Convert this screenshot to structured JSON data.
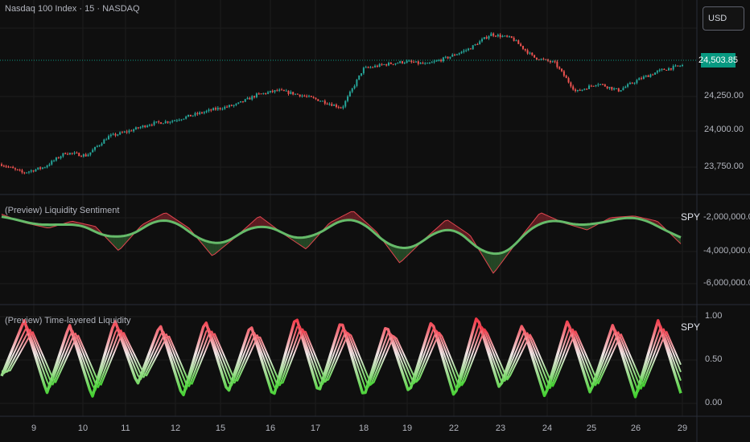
{
  "header": {
    "symbol_title": "Nasdaq 100 Index · 15 · NASDAQ",
    "currency_button": "USD",
    "last_price": "24,503.85"
  },
  "price_axis": [
    "24,250.00",
    "24,000.00",
    "23,750.00"
  ],
  "panes": {
    "liquidity_sentiment": {
      "title": "(Preview) Liquidity Sentiment",
      "badge": "SPY",
      "axis": [
        "-2,000,000.00",
        "-4,000,000.00",
        "-6,000,000.00"
      ]
    },
    "time_layered_liquidity": {
      "title": "(Preview) Time-layered Liquidity",
      "badge": "SPY",
      "axis": [
        "1.00",
        "0.50",
        "0.00"
      ]
    }
  },
  "time_axis": [
    "9",
    "10",
    "11",
    "12",
    "15",
    "16",
    "17",
    "18",
    "19",
    "22",
    "23",
    "24",
    "25",
    "26",
    "29"
  ],
  "colors": {
    "up_candle": "#26a69a",
    "down_candle": "#ef5350",
    "bear_line": "#f23645",
    "bull_fill": "#4caf50",
    "last_price_badge": "#089981"
  },
  "chart_data": [
    {
      "type": "candlestick",
      "title": "Nasdaq 100 Index · 15 · NASDAQ",
      "x": [
        "9",
        "10",
        "11",
        "12",
        "15",
        "16",
        "17",
        "18",
        "19",
        "22",
        "23",
        "24",
        "25",
        "26"
      ],
      "close_path": [
        23820,
        23760,
        23800,
        23900,
        23880,
        24010,
        24050,
        24100,
        24120,
        24160,
        24200,
        24230,
        24300,
        24330,
        24300,
        24260,
        24210,
        24480,
        24510,
        24530,
        24510,
        24560,
        24620,
        24720,
        24690,
        24560,
        24520,
        24320,
        24380,
        24330,
        24410,
        24470,
        24503.85
      ],
      "last": 24503.85,
      "ylim": [
        23650,
        24900
      ]
    },
    {
      "type": "area",
      "title": "(Preview) Liquidity Sentiment",
      "series": [
        {
          "name": "SPY",
          "values": [
            -1800000,
            -2300000,
            -2600000,
            -2200000,
            -2500000,
            -3900000,
            -2400000,
            -1700000,
            -2600000,
            -4200000,
            -3100000,
            -1900000,
            -2900000,
            -3800000,
            -2300000,
            -1600000,
            -2800000,
            -4600000,
            -3300000,
            -2100000,
            -3000000,
            -5200000,
            -3400000,
            -1700000,
            -2300000,
            -2700000,
            -2000000,
            -1900000,
            -2200000,
            -3500000
          ]
        }
      ],
      "ylim": [
        -6800000,
        -900000
      ]
    },
    {
      "type": "line",
      "title": "(Preview) Time-layered Liquidity",
      "series": [
        {
          "name": "SPY",
          "values": [
            0.3,
            0.95,
            0.1,
            0.9,
            0.05,
            0.95,
            0.2,
            0.9,
            0.05,
            0.95,
            0.1,
            0.9,
            0.05,
            1.0,
            0.1,
            0.95,
            0.05,
            0.9,
            0.1,
            0.95,
            0.05,
            1.0,
            0.15,
            0.9,
            0.05,
            0.95,
            0.1,
            0.9,
            0.05,
            0.95,
            0.1
          ]
        }
      ],
      "ylim": [
        0,
        1
      ]
    }
  ]
}
